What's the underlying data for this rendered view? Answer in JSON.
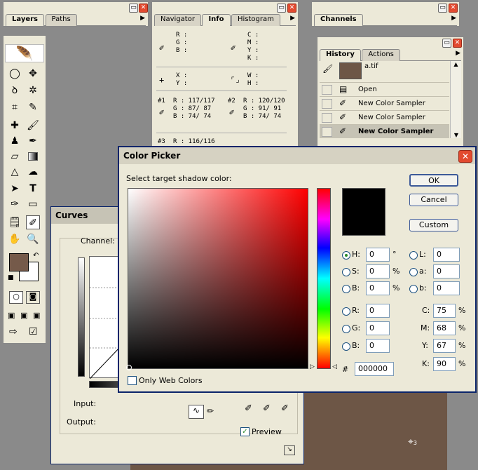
{
  "layers_panel": {
    "tabs": [
      "Layers",
      "Paths"
    ],
    "active": "Layers"
  },
  "info_panel": {
    "tabs": [
      "Navigator",
      "Info",
      "Histogram"
    ],
    "active": "Info",
    "rgb_labels": [
      "R :",
      "G :",
      "B :"
    ],
    "cmyk_labels": [
      "C :",
      "M :",
      "Y :",
      "K :"
    ],
    "xy_labels": [
      "X :",
      "Y :"
    ],
    "wh_labels": [
      "W :",
      "H :"
    ],
    "sampler1": {
      "id": "#1",
      "R": "R :  117/117",
      "G": "G :   87/ 87",
      "B": "B :   74/ 74"
    },
    "sampler2": {
      "id": "#2",
      "R": "R :  120/120",
      "G": "G :   91/ 91",
      "B": "B :   74/ 74"
    },
    "sampler3": {
      "id": "#3",
      "R": "R :  116/116"
    }
  },
  "channels_panel": {
    "title": "Channels"
  },
  "history_panel": {
    "tabs": [
      "History",
      "Actions"
    ],
    "active": "History",
    "snapshot": "a.tif",
    "items": [
      "Open",
      "New Color Sampler",
      "New Color Sampler",
      "New Color Sampler"
    ]
  },
  "curves": {
    "title": "Curves",
    "channel_label": "Channel:",
    "input_label": "Input:",
    "output_label": "Output:",
    "preview_label": "Preview"
  },
  "color_picker": {
    "title": "Color Picker",
    "prompt": "Select target shadow color:",
    "ok": "OK",
    "cancel": "Cancel",
    "custom": "Custom",
    "only_web_colors": "Only Web Colors",
    "hsb": {
      "H": "0",
      "S": "0",
      "B": "0",
      "H_unit": "°",
      "S_unit": "%",
      "B_unit": "%"
    },
    "rgb": {
      "R": "0",
      "G": "0",
      "B": "0"
    },
    "lab": {
      "L": "0",
      "a": "0",
      "b": "0"
    },
    "cmyk": {
      "C": "75",
      "M": "68",
      "Y": "67",
      "K": "90",
      "unit": "%"
    },
    "hex": "000000",
    "labels": {
      "H": "H:",
      "S": "S:",
      "B": "B:",
      "R": "R:",
      "G": "G:",
      "Bb": "B:",
      "L": "L:",
      "a": "a:",
      "b": "b:",
      "C": "C:",
      "M": "M:",
      "Y": "Y:",
      "K": "K:",
      "hash": "#"
    }
  },
  "colors": {
    "foreground": "#755a4a",
    "image_bg": "#6d5646",
    "hue_field": "#ff0000"
  }
}
